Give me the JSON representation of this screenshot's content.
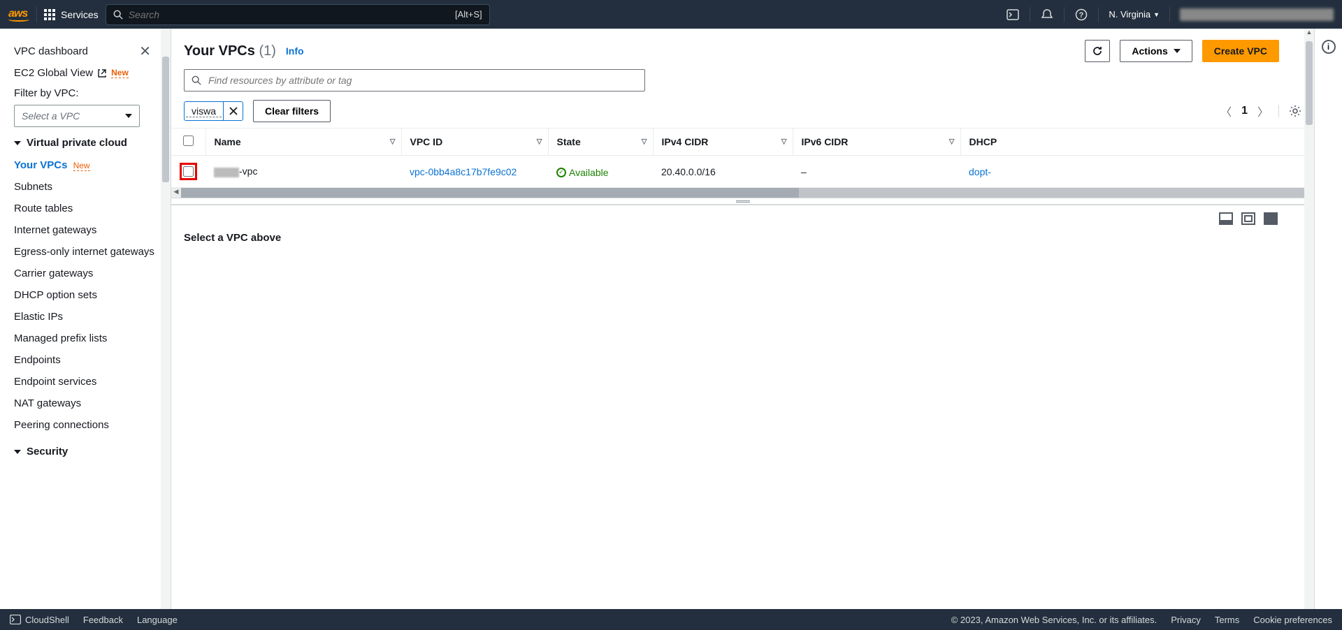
{
  "topnav": {
    "services": "Services",
    "search_placeholder": "Search",
    "shortcut": "[Alt+S]",
    "region": "N. Virginia"
  },
  "sidebar": {
    "dashboard": "VPC dashboard",
    "ec2_global": "EC2 Global View",
    "new_badge": "New",
    "filter_label": "Filter by VPC:",
    "select_placeholder": "Select a VPC",
    "sections": {
      "vpc": "Virtual private cloud",
      "security": "Security"
    },
    "items": {
      "your_vpcs": "Your VPCs",
      "subnets": "Subnets",
      "route_tables": "Route tables",
      "igw": "Internet gateways",
      "egress": "Egress-only internet gateways",
      "carrier": "Carrier gateways",
      "dhcp": "DHCP option sets",
      "eips": "Elastic IPs",
      "prefix": "Managed prefix lists",
      "endpoints": "Endpoints",
      "endpoint_svc": "Endpoint services",
      "nat": "NAT gateways",
      "peering": "Peering connections"
    }
  },
  "page": {
    "title": "Your VPCs",
    "count": "(1)",
    "info": "Info",
    "actions": "Actions",
    "create": "Create VPC",
    "search_placeholder": "Find resources by attribute or tag",
    "filter_tag": "viswa",
    "clear_filters": "Clear filters",
    "page_num": "1"
  },
  "table": {
    "cols": {
      "name": "Name",
      "vpc_id": "VPC ID",
      "state": "State",
      "ipv4": "IPv4 CIDR",
      "ipv6": "IPv6 CIDR",
      "dhcp": "DHCP"
    },
    "row": {
      "name_suffix": "-vpc",
      "vpc_id": "vpc-0bb4a8c17b7fe9c02",
      "state": "Available",
      "ipv4": "20.40.0.0/16",
      "ipv6": "–",
      "dhcp": "dopt-"
    }
  },
  "detail": {
    "empty": "Select a VPC above"
  },
  "footer": {
    "cloudshell": "CloudShell",
    "feedback": "Feedback",
    "language": "Language",
    "copyright": "© 2023, Amazon Web Services, Inc. or its affiliates.",
    "privacy": "Privacy",
    "terms": "Terms",
    "cookies": "Cookie preferences"
  }
}
